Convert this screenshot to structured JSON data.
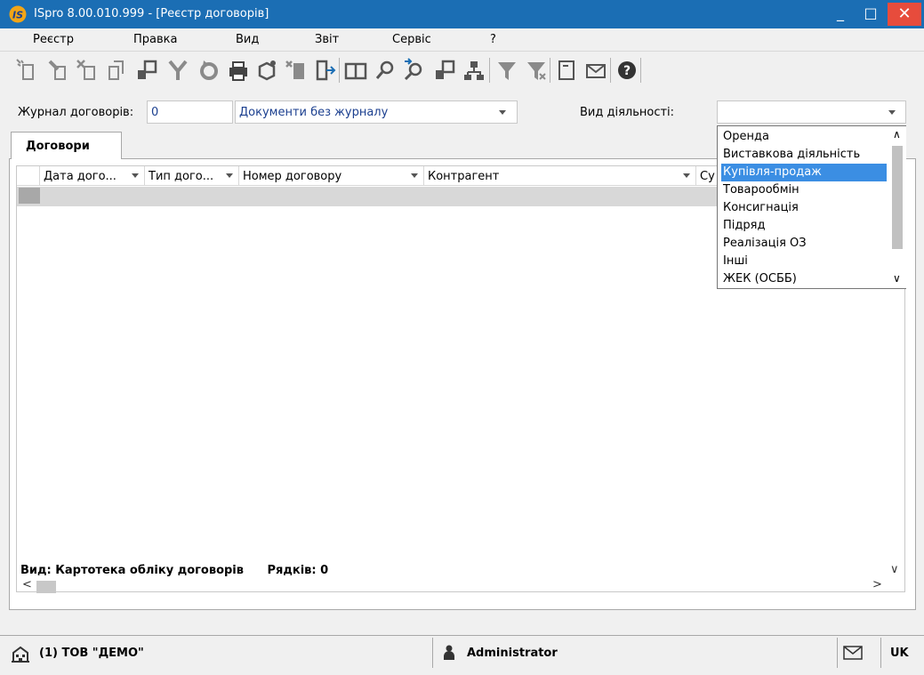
{
  "window": {
    "title": "ISpro 8.00.010.999 - [Реєстр договорів]",
    "min": "_",
    "max": "□",
    "close": "✕"
  },
  "menu": [
    "Реєстр",
    "Правка",
    "Вид",
    "Звіт",
    "Сервіс",
    "?"
  ],
  "toolbar": {
    "icons": [
      "create-icon",
      "edit-icon",
      "delete-icon",
      "copy-icon",
      "import-icon",
      "merge-icon",
      "refresh-icon",
      "print-icon",
      "archive-icon",
      "transfer-icon",
      "exit-icon",
      "book-icon",
      "search-icon",
      "search-next-icon",
      "export-icon",
      "hierarchy-icon",
      "filter-icon",
      "clear-filter-icon",
      "document-icon",
      "mail-icon",
      "help-icon"
    ]
  },
  "filters": {
    "journal_label": "Журнал договорів:",
    "journal_code": "0",
    "journal_value": "Документи без журналу",
    "activity_label": "Вид діяльності:",
    "activity_value": ""
  },
  "tab": {
    "label": "Договори"
  },
  "grid": {
    "columns": [
      "Дата дого...",
      "Тип дого...",
      "Номер договору",
      "Контрагент",
      "Су"
    ],
    "footer_view": "Вид: Картотека обліку договорів",
    "footer_rows": "Рядків: 0"
  },
  "dropdown": {
    "options": [
      "Оренда",
      "Виставкова діяльність",
      "Купівля-продаж",
      "Товарообмін",
      "Консигнація",
      "Підряд",
      "Реалізація ОЗ",
      "Інші",
      "ЖЕК (ОСББ)"
    ],
    "selected": "Купівля-продаж"
  },
  "status": {
    "company": "(1) ТОВ \"ДЕМО\"",
    "user": "Administrator",
    "lang": "UK"
  },
  "colors": {
    "titlebar": "#1b6eb4",
    "selection": "#3b8ee3",
    "close": "#e74c3c"
  }
}
